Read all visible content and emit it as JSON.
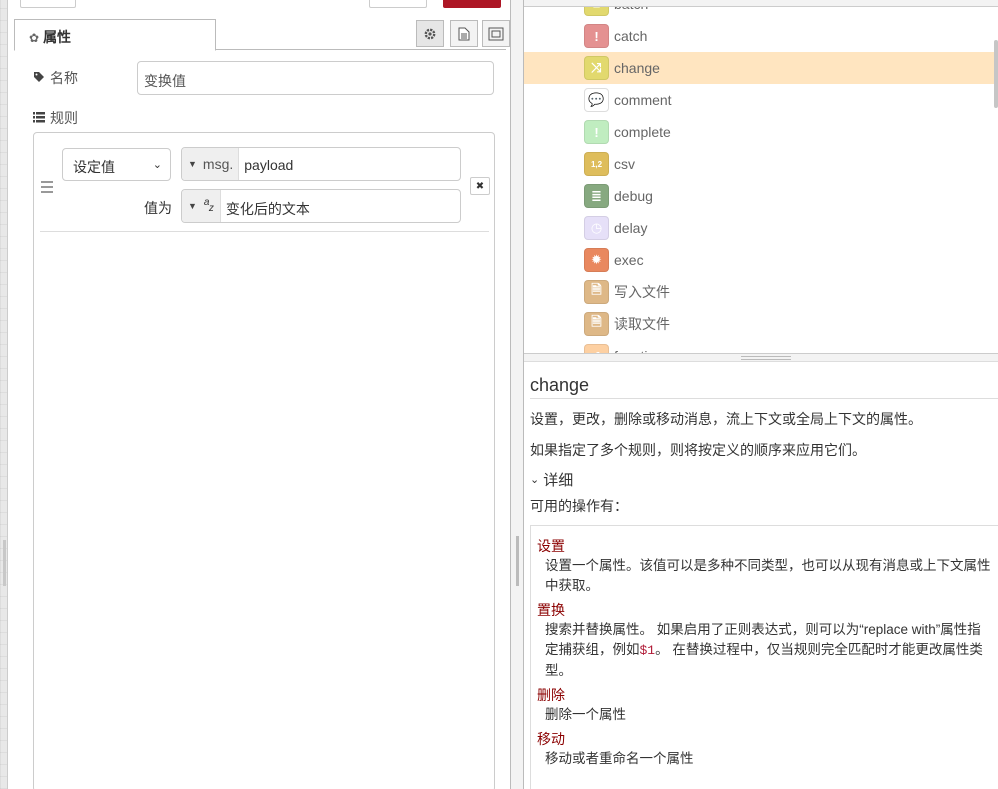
{
  "editor": {
    "tab_properties": "属性",
    "name_label": "名称",
    "name_value": "变换值",
    "rules_label": "规则",
    "rule": {
      "action": "设定值",
      "target_prefix": "msg.",
      "target_value": "payload",
      "value_label": "值为",
      "value_text": "变化后的文本"
    }
  },
  "palette": {
    "items": [
      {
        "label": "batch",
        "color": "#e2d96e",
        "icon": "batch-icon"
      },
      {
        "label": "catch",
        "color": "#e49191",
        "icon": "exclamation-icon"
      },
      {
        "label": "change",
        "color": "#e2d96e",
        "icon": "shuffle-icon"
      },
      {
        "label": "comment",
        "color": "#ffffff",
        "icon": "comment-icon"
      },
      {
        "label": "complete",
        "color": "#c0edc0",
        "icon": "exclamation-icon"
      },
      {
        "label": "csv",
        "color": "#debd5c",
        "icon": "csv-icon"
      },
      {
        "label": "debug",
        "color": "#87a980",
        "icon": "debug-icon"
      },
      {
        "label": "delay",
        "color": "#e6e0f8",
        "icon": "clock-icon"
      },
      {
        "label": "exec",
        "color": "#e9885f",
        "icon": "gear-icon"
      },
      {
        "label": "写入文件",
        "color": "#deb887",
        "icon": "file-out-icon"
      },
      {
        "label": "读取文件",
        "color": "#deb887",
        "icon": "file-in-icon"
      },
      {
        "label": "function",
        "color": "#fdd0a2",
        "icon": "function-icon"
      }
    ]
  },
  "help": {
    "title": "change",
    "p1": "设置，更改，删除或移动消息，流上下文或全局上下文的属性。",
    "p2": "如果指定了多个规则，则将按定义的顺序来应用它们。",
    "details": "详细",
    "ops_intro": "可用的操作有：",
    "ops": [
      {
        "term": "设置",
        "desc": "设置一个属性。该值可以是多种不同类型，也可以从现有消息或上下文属性中获取。"
      },
      {
        "term": "置换",
        "desc_pre": "搜索并替换属性。 如果启用了正则表达式，则可以为“replace with”属性指定捕获组，例如",
        "desc_code": "$1",
        "desc_post": "。 在替换过程中，仅当规则完全匹配时才能更改属性类型。"
      },
      {
        "term": "删除",
        "desc": "删除一个属性"
      },
      {
        "term": "移动",
        "desc": "移动或者重命名一个属性"
      }
    ]
  }
}
